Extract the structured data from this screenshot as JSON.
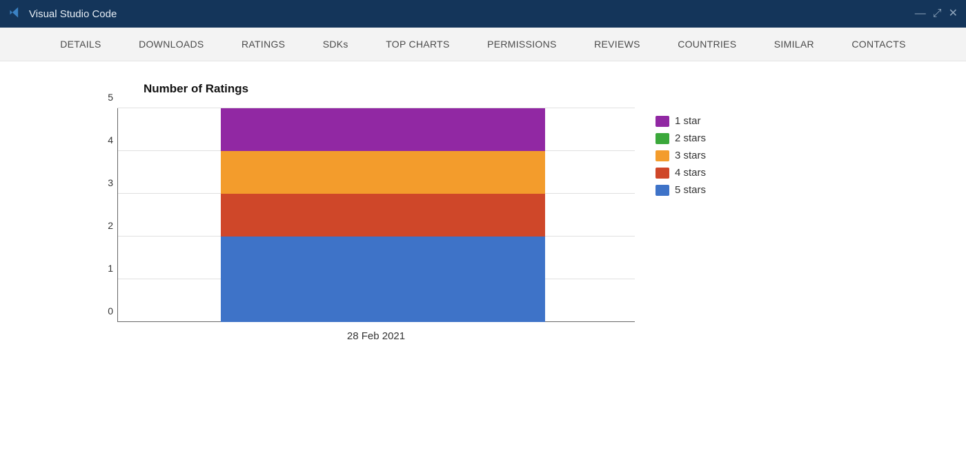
{
  "window": {
    "title": "Visual Studio Code"
  },
  "tabs": [
    "DETAILS",
    "DOWNLOADS",
    "RATINGS",
    "SDKs",
    "TOP CHARTS",
    "PERMISSIONS",
    "REVIEWS",
    "COUNTRIES",
    "SIMILAR",
    "CONTACTS"
  ],
  "chart_data": {
    "type": "bar",
    "title": "Number of Ratings",
    "categories": [
      "28 Feb 2021"
    ],
    "series": [
      {
        "name": "1 star",
        "values": [
          1
        ],
        "color": "#9128a3"
      },
      {
        "name": "2 stars",
        "values": [
          0
        ],
        "color": "#3ba83b"
      },
      {
        "name": "3 stars",
        "values": [
          1
        ],
        "color": "#f39c2c"
      },
      {
        "name": "4 stars",
        "values": [
          1
        ],
        "color": "#cf4729"
      },
      {
        "name": "5 stars",
        "values": [
          2
        ],
        "color": "#3e73c8"
      }
    ],
    "ylim": [
      0,
      5
    ],
    "yticks": [
      0,
      1,
      2,
      3,
      4,
      5
    ],
    "stacked": true,
    "xlabel": "",
    "ylabel": ""
  }
}
